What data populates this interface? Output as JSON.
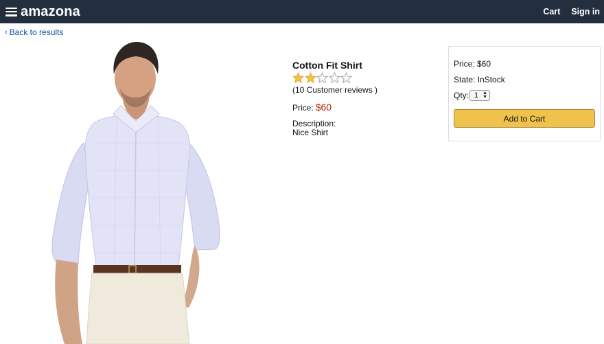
{
  "header": {
    "brand": "amazona",
    "cart_label": "Cart",
    "signin_label": "Sign in",
    "background_color": "#232f3e"
  },
  "navigation": {
    "back_label": "Back to results",
    "back_icon": "chevron-left-icon"
  },
  "product": {
    "name": "Cotton Fit Shirt",
    "rating": 2,
    "rating_max": 5,
    "reviews_text": "(10 Customer reviews )",
    "price_label": "Price:",
    "price_value": "$60",
    "price_color": "#b12704",
    "description_label": "Description:",
    "description_text": "Nice Shirt",
    "image_icon": "product-shirt-image"
  },
  "buybox": {
    "price_text": "Price: $60",
    "state_text": "State: InStock",
    "qty_label": "Qty:",
    "qty_value": "1",
    "add_to_cart_label": "Add to Cart",
    "button_color": "#f0c14b"
  }
}
